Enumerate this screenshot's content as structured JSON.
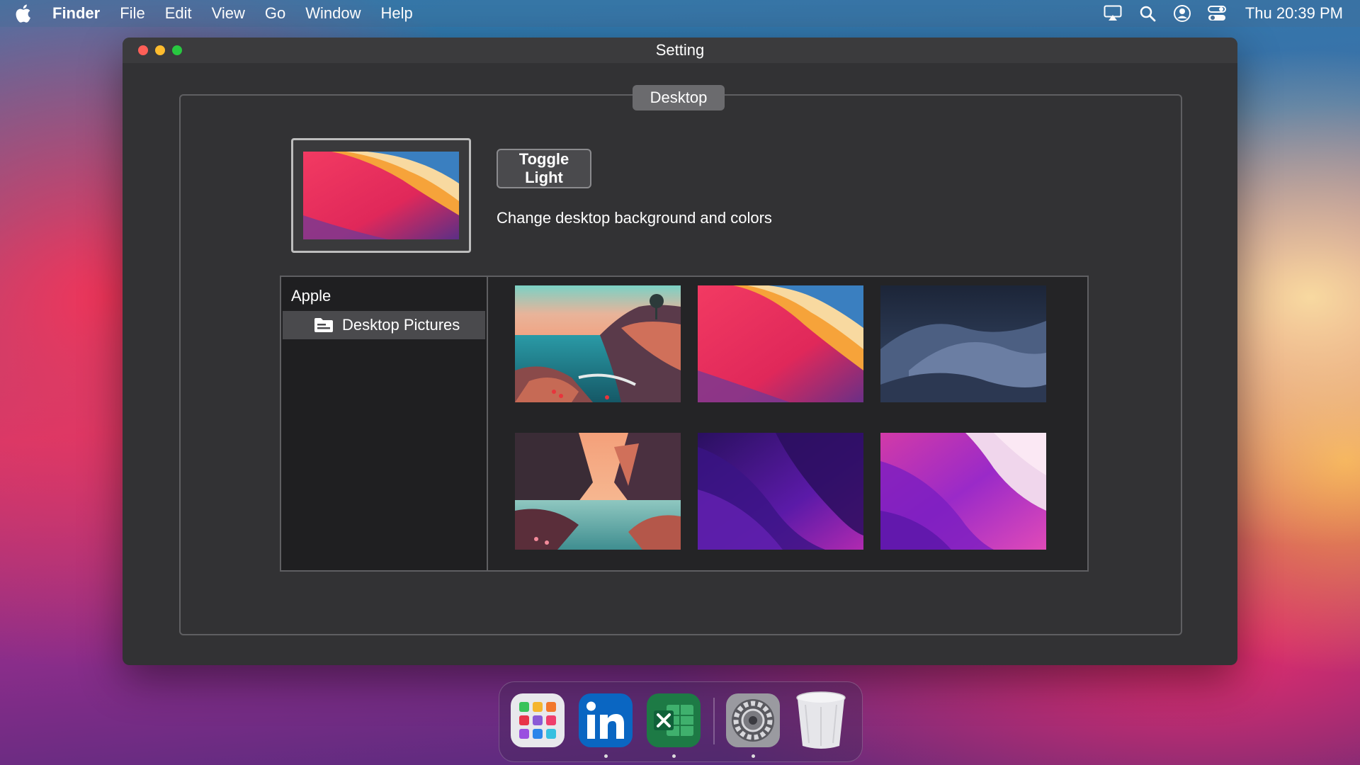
{
  "menubar": {
    "apple_icon": "apple-logo-icon",
    "app_name": "Finder",
    "items": [
      "File",
      "Edit",
      "View",
      "Go",
      "Window",
      "Help"
    ],
    "status_icons": [
      "airplay-icon",
      "search-icon",
      "user-icon",
      "control-center-icon"
    ],
    "clock": "Thu 20:39 PM"
  },
  "window": {
    "title": "Setting",
    "group_label": "Desktop",
    "toggle_button": "Toggle Light",
    "description": "Change desktop background and colors",
    "sidebar": {
      "section": "Apple",
      "item": "Desktop Pictures"
    },
    "thumbnails": [
      {
        "name": "coastal-cliffs-wallpaper"
      },
      {
        "name": "big-sur-waves-wallpaper"
      },
      {
        "name": "mojave-night-dunes-wallpaper"
      },
      {
        "name": "canyon-river-wallpaper"
      },
      {
        "name": "monterey-dark-purple-wallpaper"
      },
      {
        "name": "monterey-pink-purple-wallpaper"
      }
    ]
  },
  "dock": {
    "apps": [
      "launchpad-icon",
      "linkedin-icon",
      "excel-icon",
      "system-preferences-icon",
      "trash-icon"
    ]
  },
  "colors": {
    "window_bg": "#323234",
    "accent_red": "#ff5f57",
    "accent_yellow": "#febc2e",
    "accent_green": "#28c840"
  }
}
